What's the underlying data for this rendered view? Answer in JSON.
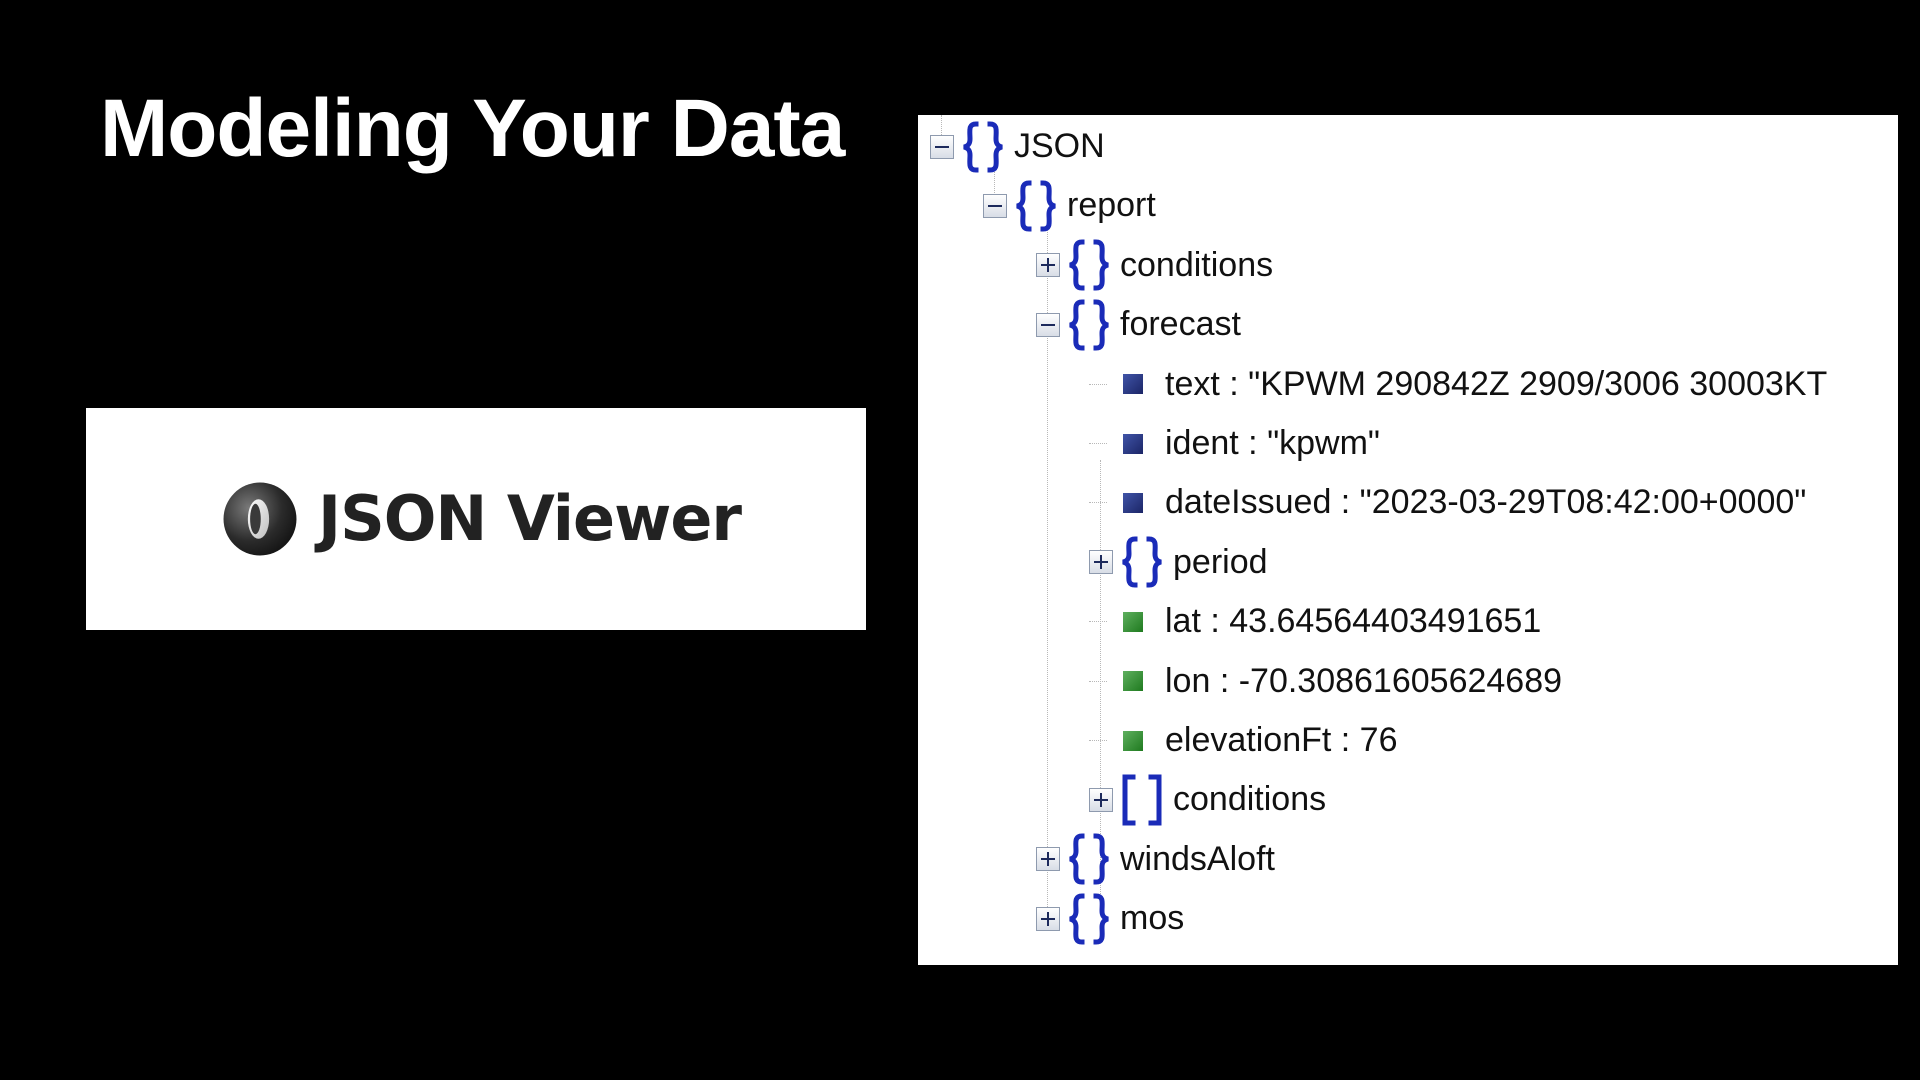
{
  "slide": {
    "title": "Modeling Your Data"
  },
  "logo": {
    "text": "JSON Viewer",
    "icon": "json-viewer-logo-icon"
  },
  "tree": {
    "nodes": [
      {
        "label": "JSON",
        "kind": "object",
        "expanded": true,
        "depth": 0
      },
      {
        "label": "report",
        "kind": "object",
        "expanded": true,
        "depth": 1
      },
      {
        "label": "conditions",
        "kind": "object",
        "expanded": false,
        "depth": 2
      },
      {
        "label": "forecast",
        "kind": "object",
        "expanded": true,
        "depth": 2
      },
      {
        "label": "text : \"KPWM 290842Z 2909/3006 30003KT",
        "kind": "string",
        "depth": 3
      },
      {
        "label": "ident : \"kpwm\"",
        "kind": "string",
        "depth": 3
      },
      {
        "label": "dateIssued : \"2023-03-29T08:42:00+0000\"",
        "kind": "string",
        "depth": 3
      },
      {
        "label": "period",
        "kind": "object",
        "expanded": false,
        "depth": 3
      },
      {
        "label": "lat : 43.64564403491651",
        "kind": "number",
        "depth": 3
      },
      {
        "label": "lon : -70.30861605624689",
        "kind": "number",
        "depth": 3
      },
      {
        "label": "elevationFt : 76",
        "kind": "number",
        "depth": 3
      },
      {
        "label": "conditions",
        "kind": "array",
        "expanded": false,
        "depth": 3
      },
      {
        "label": "windsAloft",
        "kind": "object",
        "expanded": false,
        "depth": 2
      },
      {
        "label": "mos",
        "kind": "object",
        "expanded": false,
        "depth": 2
      }
    ]
  },
  "colors": {
    "background": "#000000",
    "title": "#ffffff",
    "bracket": "#1a2bb8",
    "string_leaf": "#2a3a8c",
    "number_leaf": "#2e8b2e"
  }
}
